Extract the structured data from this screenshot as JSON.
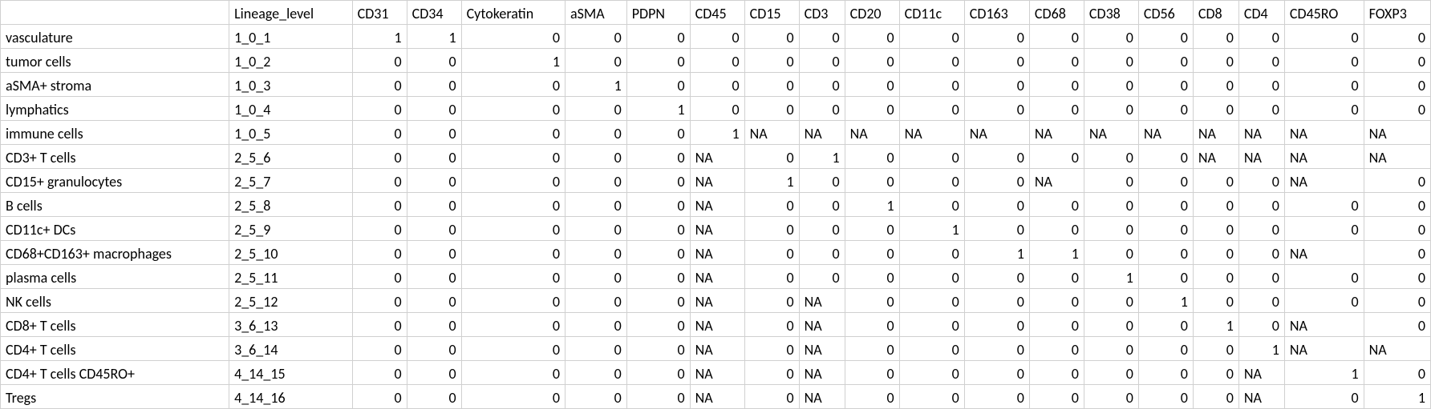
{
  "headers": [
    "",
    "Lineage_level",
    "CD31",
    "CD34",
    "Cytokeratin",
    "aSMA",
    "PDPN",
    "CD45",
    "CD15",
    "CD3",
    "CD20",
    "CD11c",
    "CD163",
    "CD68",
    "CD38",
    "CD56",
    "CD8",
    "CD4",
    "CD45RO",
    "FOXP3"
  ],
  "rows": [
    {
      "label": "vasculature",
      "lineage": "1_0_1",
      "vals": [
        "1",
        "1",
        "0",
        "0",
        "0",
        "0",
        "0",
        "0",
        "0",
        "0",
        "0",
        "0",
        "0",
        "0",
        "0",
        "0",
        "0",
        "0"
      ]
    },
    {
      "label": "tumor cells",
      "lineage": "1_0_2",
      "vals": [
        "0",
        "0",
        "1",
        "0",
        "0",
        "0",
        "0",
        "0",
        "0",
        "0",
        "0",
        "0",
        "0",
        "0",
        "0",
        "0",
        "0",
        "0"
      ]
    },
    {
      "label": "aSMA+ stroma",
      "lineage": "1_0_3",
      "vals": [
        "0",
        "0",
        "0",
        "1",
        "0",
        "0",
        "0",
        "0",
        "0",
        "0",
        "0",
        "0",
        "0",
        "0",
        "0",
        "0",
        "0",
        "0"
      ]
    },
    {
      "label": "lymphatics",
      "lineage": "1_0_4",
      "vals": [
        "0",
        "0",
        "0",
        "0",
        "1",
        "0",
        "0",
        "0",
        "0",
        "0",
        "0",
        "0",
        "0",
        "0",
        "0",
        "0",
        "0",
        "0"
      ]
    },
    {
      "label": "immune cells",
      "lineage": "1_0_5",
      "vals": [
        "0",
        "0",
        "0",
        "0",
        "0",
        "1",
        "NA",
        "NA",
        "NA",
        "NA",
        "NA",
        "NA",
        "NA",
        "NA",
        "NA",
        "NA",
        "NA",
        "NA"
      ]
    },
    {
      "label": "CD3+ T cells",
      "lineage": "2_5_6",
      "vals": [
        "0",
        "0",
        "0",
        "0",
        "0",
        "NA",
        "0",
        "1",
        "0",
        "0",
        "0",
        "0",
        "0",
        "0",
        "NA",
        "NA",
        "NA",
        "NA"
      ]
    },
    {
      "label": "CD15+ granulocytes",
      "lineage": "2_5_7",
      "vals": [
        "0",
        "0",
        "0",
        "0",
        "0",
        "NA",
        "1",
        "0",
        "0",
        "0",
        "0",
        "NA",
        "0",
        "0",
        "0",
        "0",
        "NA",
        "0"
      ]
    },
    {
      "label": "B cells",
      "lineage": "2_5_8",
      "vals": [
        "0",
        "0",
        "0",
        "0",
        "0",
        "NA",
        "0",
        "0",
        "1",
        "0",
        "0",
        "0",
        "0",
        "0",
        "0",
        "0",
        "0",
        "0"
      ]
    },
    {
      "label": "CD11c+ DCs",
      "lineage": "2_5_9",
      "vals": [
        "0",
        "0",
        "0",
        "0",
        "0",
        "NA",
        "0",
        "0",
        "0",
        "1",
        "0",
        "0",
        "0",
        "0",
        "0",
        "0",
        "0",
        "0"
      ]
    },
    {
      "label": "CD68+CD163+ macrophages",
      "lineage": "2_5_10",
      "vals": [
        "0",
        "0",
        "0",
        "0",
        "0",
        "NA",
        "0",
        "0",
        "0",
        "0",
        "1",
        "1",
        "0",
        "0",
        "0",
        "0",
        "NA",
        "0"
      ]
    },
    {
      "label": "plasma cells",
      "lineage": "2_5_11",
      "vals": [
        "0",
        "0",
        "0",
        "0",
        "0",
        "NA",
        "0",
        "0",
        "0",
        "0",
        "0",
        "0",
        "1",
        "0",
        "0",
        "0",
        "0",
        "0"
      ]
    },
    {
      "label": "NK cells",
      "lineage": "2_5_12",
      "vals": [
        "0",
        "0",
        "0",
        "0",
        "0",
        "NA",
        "0",
        "NA",
        "0",
        "0",
        "0",
        "0",
        "0",
        "1",
        "0",
        "0",
        "0",
        "0"
      ]
    },
    {
      "label": "CD8+ T cells",
      "lineage": "3_6_13",
      "vals": [
        "0",
        "0",
        "0",
        "0",
        "0",
        "NA",
        "0",
        "NA",
        "0",
        "0",
        "0",
        "0",
        "0",
        "0",
        "1",
        "0",
        "NA",
        "0"
      ]
    },
    {
      "label": "CD4+ T cells",
      "lineage": "3_6_14",
      "vals": [
        "0",
        "0",
        "0",
        "0",
        "0",
        "NA",
        "0",
        "NA",
        "0",
        "0",
        "0",
        "0",
        "0",
        "0",
        "0",
        "1",
        "NA",
        "NA"
      ]
    },
    {
      "label": "CD4+ T cells CD45RO+",
      "lineage": "4_14_15",
      "vals": [
        "0",
        "0",
        "0",
        "0",
        "0",
        "NA",
        "0",
        "NA",
        "0",
        "0",
        "0",
        "0",
        "0",
        "0",
        "0",
        "NA",
        "1",
        "0"
      ]
    },
    {
      "label": "Tregs",
      "lineage": "4_14_16",
      "vals": [
        "0",
        "0",
        "0",
        "0",
        "0",
        "NA",
        "0",
        "NA",
        "0",
        "0",
        "0",
        "0",
        "0",
        "0",
        "0",
        "NA",
        "0",
        "1"
      ]
    }
  ],
  "chart_data": {
    "type": "table",
    "title": "",
    "columns": [
      "",
      "Lineage_level",
      "CD31",
      "CD34",
      "Cytokeratin",
      "aSMA",
      "PDPN",
      "CD45",
      "CD15",
      "CD3",
      "CD20",
      "CD11c",
      "CD163",
      "CD68",
      "CD38",
      "CD56",
      "CD8",
      "CD4",
      "CD45RO",
      "FOXP3"
    ],
    "rows": [
      [
        "vasculature",
        "1_0_1",
        1,
        1,
        0,
        0,
        0,
        0,
        0,
        0,
        0,
        0,
        0,
        0,
        0,
        0,
        0,
        0,
        0,
        0
      ],
      [
        "tumor cells",
        "1_0_2",
        0,
        0,
        1,
        0,
        0,
        0,
        0,
        0,
        0,
        0,
        0,
        0,
        0,
        0,
        0,
        0,
        0,
        0
      ],
      [
        "aSMA+ stroma",
        "1_0_3",
        0,
        0,
        0,
        1,
        0,
        0,
        0,
        0,
        0,
        0,
        0,
        0,
        0,
        0,
        0,
        0,
        0,
        0
      ],
      [
        "lymphatics",
        "1_0_4",
        0,
        0,
        0,
        0,
        1,
        0,
        0,
        0,
        0,
        0,
        0,
        0,
        0,
        0,
        0,
        0,
        0,
        0
      ],
      [
        "immune cells",
        "1_0_5",
        0,
        0,
        0,
        0,
        0,
        1,
        "NA",
        "NA",
        "NA",
        "NA",
        "NA",
        "NA",
        "NA",
        "NA",
        "NA",
        "NA",
        "NA",
        "NA"
      ],
      [
        "CD3+ T cells",
        "2_5_6",
        0,
        0,
        0,
        0,
        0,
        "NA",
        0,
        1,
        0,
        0,
        0,
        0,
        0,
        0,
        "NA",
        "NA",
        "NA",
        "NA"
      ],
      [
        "CD15+ granulocytes",
        "2_5_7",
        0,
        0,
        0,
        0,
        0,
        "NA",
        1,
        0,
        0,
        0,
        0,
        "NA",
        0,
        0,
        0,
        0,
        "NA",
        0
      ],
      [
        "B cells",
        "2_5_8",
        0,
        0,
        0,
        0,
        0,
        "NA",
        0,
        0,
        1,
        0,
        0,
        0,
        0,
        0,
        0,
        0,
        0,
        0
      ],
      [
        "CD11c+ DCs",
        "2_5_9",
        0,
        0,
        0,
        0,
        0,
        "NA",
        0,
        0,
        0,
        1,
        0,
        0,
        0,
        0,
        0,
        0,
        0,
        0
      ],
      [
        "CD68+CD163+ macrophages",
        "2_5_10",
        0,
        0,
        0,
        0,
        0,
        "NA",
        0,
        0,
        0,
        0,
        1,
        1,
        0,
        0,
        0,
        0,
        "NA",
        0
      ],
      [
        "plasma cells",
        "2_5_11",
        0,
        0,
        0,
        0,
        0,
        "NA",
        0,
        0,
        0,
        0,
        0,
        0,
        1,
        0,
        0,
        0,
        0,
        0
      ],
      [
        "NK cells",
        "2_5_12",
        0,
        0,
        0,
        0,
        0,
        "NA",
        0,
        "NA",
        0,
        0,
        0,
        0,
        0,
        1,
        0,
        0,
        0,
        0
      ],
      [
        "CD8+ T cells",
        "3_6_13",
        0,
        0,
        0,
        0,
        0,
        "NA",
        0,
        "NA",
        0,
        0,
        0,
        0,
        0,
        0,
        1,
        0,
        "NA",
        0
      ],
      [
        "CD4+ T cells",
        "3_6_14",
        0,
        0,
        0,
        0,
        0,
        "NA",
        0,
        "NA",
        0,
        0,
        0,
        0,
        0,
        0,
        0,
        1,
        "NA",
        "NA"
      ],
      [
        "CD4+ T cells CD45RO+",
        "4_14_15",
        0,
        0,
        0,
        0,
        0,
        "NA",
        0,
        "NA",
        0,
        0,
        0,
        0,
        0,
        0,
        0,
        "NA",
        1,
        0
      ],
      [
        "Tregs",
        "4_14_16",
        0,
        0,
        0,
        0,
        0,
        "NA",
        0,
        "NA",
        0,
        0,
        0,
        0,
        0,
        0,
        0,
        "NA",
        0,
        1
      ]
    ]
  }
}
